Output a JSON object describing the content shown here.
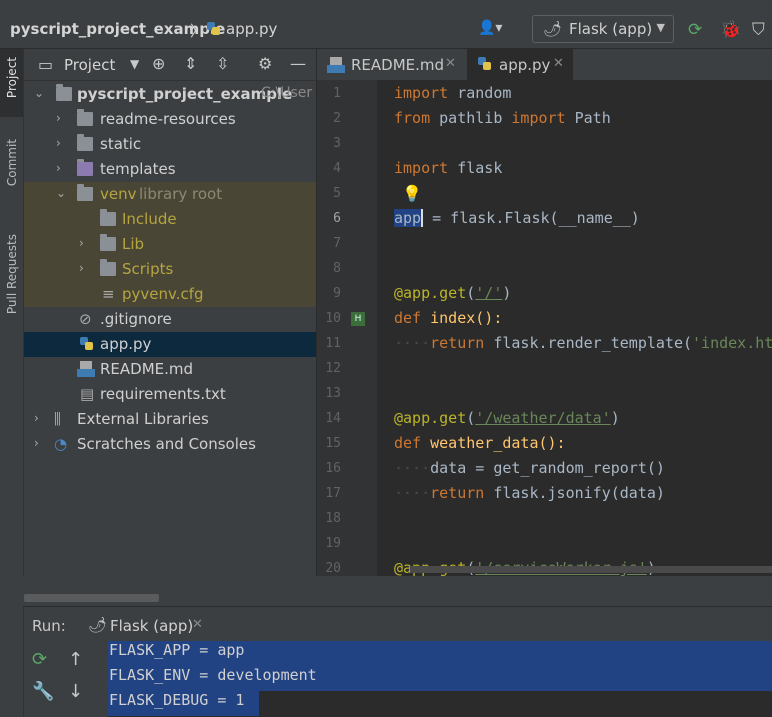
{
  "breadcrumb": {
    "project": "pyscript_project_example",
    "file": "app.py"
  },
  "run_config": {
    "label": "Flask (app)"
  },
  "toolbar": {
    "rerun_icon": "run-icon",
    "debug_icon": "debug-icon",
    "coverage_icon": "coverage-icon"
  },
  "left_strip": {
    "tabs": [
      "Project",
      "Commit",
      "Pull Requests"
    ]
  },
  "project_panel": {
    "title": "Project",
    "tree": [
      {
        "label": "pyscript_project_example",
        "suffix": "C:\\User"
      },
      {
        "label": "readme-resources"
      },
      {
        "label": "static"
      },
      {
        "label": "templates"
      },
      {
        "label": "venv",
        "suffix": "library root"
      },
      {
        "label": "Include"
      },
      {
        "label": "Lib"
      },
      {
        "label": "Scripts"
      },
      {
        "label": "pyvenv.cfg"
      },
      {
        "label": ".gitignore"
      },
      {
        "label": "app.py"
      },
      {
        "label": "README.md"
      },
      {
        "label": "requirements.txt"
      },
      {
        "label": "External Libraries"
      },
      {
        "label": "Scratches and Consoles"
      }
    ]
  },
  "editor": {
    "tabs": [
      {
        "name": "README.md"
      },
      {
        "name": "app.py"
      }
    ],
    "line_numbers": [
      "1",
      "2",
      "3",
      "4",
      "5",
      "6",
      "7",
      "8",
      "9",
      "10",
      "11",
      "12",
      "13",
      "14",
      "15",
      "16",
      "17",
      "18",
      "19",
      "20"
    ],
    "code": {
      "l1_kw": "import",
      "l1_rest": " random",
      "l2_kw1": "from",
      "l2_mid": " pathlib ",
      "l2_kw2": "import",
      "l2_rest": " Path",
      "l4_kw": "import",
      "l4_rest": " flask",
      "l6_app": "app",
      "l6_rest": " = flask.Flask(__name__)",
      "l9_dec": "@app.get",
      "l9_p1": "(",
      "l9_str": "'/'",
      "l9_p2": ")",
      "l10_kw": "def",
      "l10_rest": " index():",
      "l11_dots": "····",
      "l11_kw": "return",
      "l11_mid": " flask.render_template(",
      "l11_str": "'index.html'",
      "l14_dec": "@app.get",
      "l14_p1": "(",
      "l14_str": "'/weather/data'",
      "l14_p2": ")",
      "l15_kw": "def",
      "l15_rest": " weather_data():",
      "l16_dots": "····",
      "l16_rest": "data = get_random_report()",
      "l17_dots": "····",
      "l17_kw": "return",
      "l17_rest": " flask.jsonify(data)",
      "l20_dec": "@app.get",
      "l20_p1": "(",
      "l20_str": "'/serviceWorker.js'",
      "l20_p2": ")"
    }
  },
  "run_panel": {
    "label": "Run:",
    "tab_name": "Flask (app)",
    "console_lines": [
      "FLASK_APP = app",
      "FLASK_ENV = development",
      "FLASK_DEBUG = 1"
    ]
  },
  "colors": {
    "accent": "#4a88c7",
    "keyword": "#cc7832",
    "string": "#6a8759",
    "decorator": "#bbb529"
  }
}
